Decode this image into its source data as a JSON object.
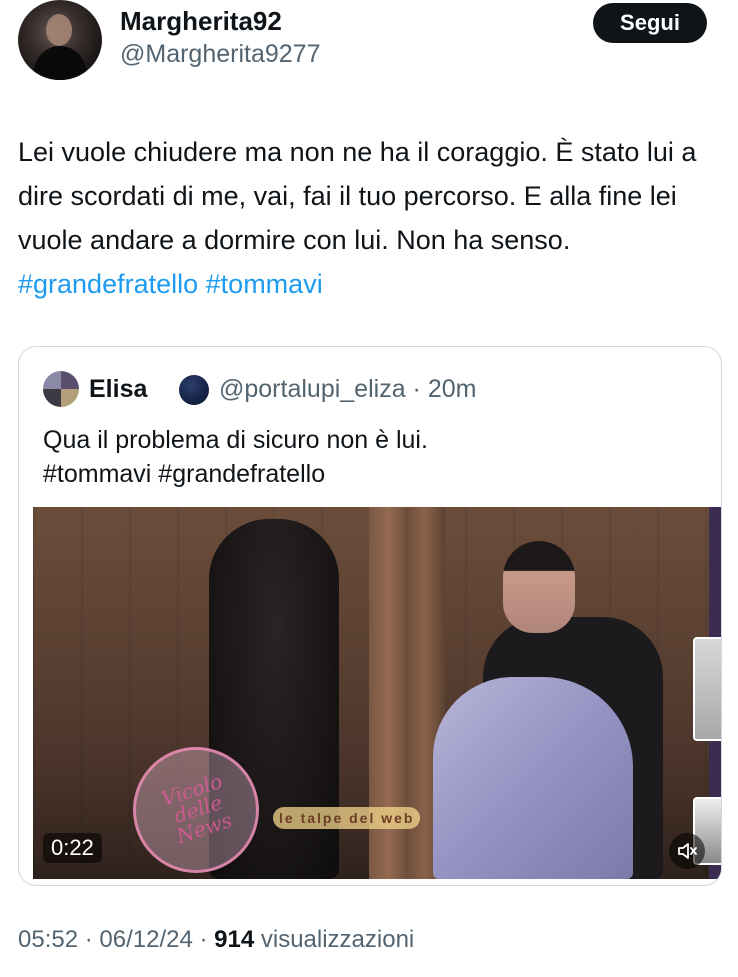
{
  "author": {
    "display_name": "Margherita92",
    "handle": "@Margherita9277"
  },
  "follow_label": "Segui",
  "tweet": {
    "text_plain": "Lei vuole chiudere ma non ne ha il coraggio. È stato lui a dire scordati di me, vai, fai il tuo percorso. E alla fine lei vuole andare a dormire con lui. Non ha senso.",
    "hashtag_1": "#grandefratello",
    "hashtag_2": "#tommavi"
  },
  "quoted": {
    "display_name": "Elisa",
    "meta": "@portalupi_eliza · 20m",
    "text_line1": "Qua il problema di sicuro non è lui.",
    "text_line2": "#tommavi #grandefratello",
    "video_duration": "0:22"
  },
  "watermark": {
    "circle_text": "Vicolo delle News",
    "banner_text": "le talpe del web"
  },
  "footer": {
    "time_date": "05:52 · 06/12/24 ·",
    "views_count": "914",
    "views_label": "visualizzazioni"
  },
  "colors": {
    "link": "#1d9bf0",
    "text": "#0f1419",
    "muted": "#536471",
    "follow_bg": "#0f1419"
  }
}
